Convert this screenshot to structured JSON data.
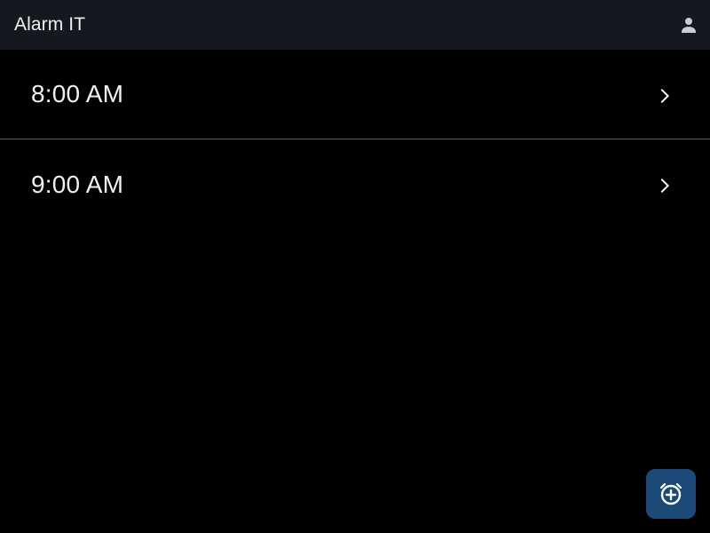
{
  "app": {
    "title": "Alarm IT"
  },
  "header": {
    "account_icon": "person-icon"
  },
  "alarms": [
    {
      "time": "8:00 AM",
      "icon": "chevron-right-icon"
    },
    {
      "time": "9:00 AM",
      "icon": "chevron-right-icon"
    }
  ],
  "fab": {
    "icon": "alarm-add-icon"
  },
  "colors": {
    "background": "#000000",
    "topbar": "#15181d",
    "divider": "#5a5d62",
    "fab": "#1b4a78",
    "text": "#eef0f2"
  }
}
